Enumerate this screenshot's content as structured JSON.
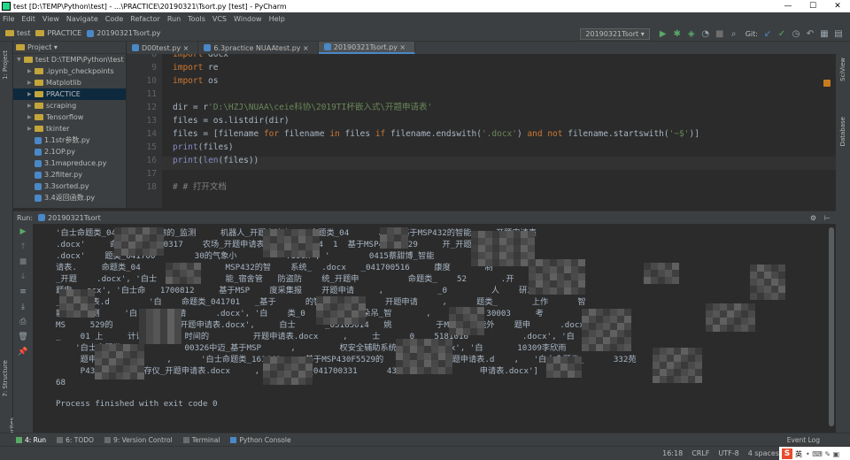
{
  "window": {
    "title": "test [D:\\TEMP\\Python\\test] - ...\\PRACTICE\\20190321\\Tsort.py [test] - PyCharm",
    "minimize": "—",
    "maximize": "☐",
    "close": "✕"
  },
  "menu": [
    "File",
    "Edit",
    "View",
    "Navigate",
    "Code",
    "Refactor",
    "Run",
    "Tools",
    "VCS",
    "Window",
    "Help"
  ],
  "breadcrumbs": [
    "test",
    "PRACTICE",
    "20190321Tsort.py"
  ],
  "run_config": "20190321Tsort ▾",
  "toolbar_icons": [
    "run-icon",
    "debug-icon",
    "coverage-icon",
    "profile-icon",
    "stop-icon",
    "search-icon",
    "git-label",
    "update-icon",
    "commit-icon",
    "history-icon",
    "revert-icon",
    "settings-icon",
    "structure-icon"
  ],
  "git_label": "Git:",
  "project": {
    "header": "Project ▾",
    "items": [
      {
        "label": "test  D:\\TEMP\\Python\\test",
        "indent": 0,
        "type": "folder",
        "open": true
      },
      {
        "label": ".ipynb_checkpoints",
        "indent": 1,
        "type": "folder"
      },
      {
        "label": "Matplotlib",
        "indent": 1,
        "type": "folder"
      },
      {
        "label": "PRACTICE",
        "indent": 1,
        "type": "folder",
        "selected": true
      },
      {
        "label": "scraping",
        "indent": 1,
        "type": "folder"
      },
      {
        "label": "Tensorflow",
        "indent": 1,
        "type": "folder"
      },
      {
        "label": "tkinter",
        "indent": 1,
        "type": "folder"
      },
      {
        "label": "1.1str参数.py",
        "indent": 1,
        "type": "file"
      },
      {
        "label": "2.1OP.py",
        "indent": 1,
        "type": "file"
      },
      {
        "label": "3.1mapreduce.py",
        "indent": 1,
        "type": "file"
      },
      {
        "label": "3.2filter.py",
        "indent": 1,
        "type": "file"
      },
      {
        "label": "3.3sorted.py",
        "indent": 1,
        "type": "file"
      },
      {
        "label": "3.4返回函数.py",
        "indent": 1,
        "type": "file"
      }
    ]
  },
  "editor_tabs": [
    "D00test.py ×",
    "6.3practice NUAAtest.py ×",
    "20190321Tsort.py ×"
  ],
  "active_tab": 2,
  "code_lines": [
    {
      "num": "8",
      "parts": [
        [
          "kw",
          "import "
        ],
        [
          "id",
          "docx"
        ]
      ]
    },
    {
      "num": "9",
      "parts": [
        [
          "kw",
          "import "
        ],
        [
          "id",
          "re"
        ]
      ]
    },
    {
      "num": "10",
      "parts": [
        [
          "kw",
          "import "
        ],
        [
          "id",
          "os"
        ]
      ]
    },
    {
      "num": "11",
      "parts": []
    },
    {
      "num": "12",
      "parts": [
        [
          "id",
          "dir = r"
        ],
        [
          "str",
          "'D:\\HZJ\\NUAA\\ceie科协\\2019TI杯嵌入式\\开题申请表'"
        ]
      ]
    },
    {
      "num": "13",
      "parts": [
        [
          "id",
          "files = os.listdir(dir)"
        ]
      ]
    },
    {
      "num": "14",
      "parts": [
        [
          "id",
          "files = [filename "
        ],
        [
          "kw",
          "for "
        ],
        [
          "id",
          "filename "
        ],
        [
          "kw",
          "in "
        ],
        [
          "id",
          "files "
        ],
        [
          "kw",
          "if "
        ],
        [
          "id",
          "filename.endswith("
        ],
        [
          "str",
          "'.docx'"
        ],
        [
          "id",
          ") "
        ],
        [
          "kw",
          "and not "
        ],
        [
          "id",
          "filename.startswith("
        ],
        [
          "str",
          "'~$'"
        ],
        [
          "id",
          ")]"
        ]
      ]
    },
    {
      "num": "15",
      "parts": [
        [
          "fn",
          "print"
        ],
        [
          "id",
          "(files)"
        ]
      ]
    },
    {
      "num": "16",
      "parts": [
        [
          "fn",
          "print"
        ],
        [
          "id",
          "("
        ],
        [
          "fn",
          "len"
        ],
        [
          "id",
          "(files))"
        ]
      ]
    },
    {
      "num": "17",
      "parts": []
    },
    {
      "num": "18",
      "parts": [
        [
          "cm",
          "# # 打开文档"
        ]
      ]
    }
  ],
  "run_panel": {
    "label": "Run:",
    "tab": "20190321Tsort"
  },
  "console_lines": [
    "'白士命题类_041601004中德的_监测     机器人_开题申请表.d  命题类_04      、5_ 基于MSP432的智能     开题申请表",
    ".docx'     命题类_041700317    农场_开题申请表    命题类_04  1  基于MSP430F5529     开_开题申请",
    ".docx'    题类_041700        30的气象小          .docx', '        0415蔡甜博_智能         体化系统_开",
    "请表.     命题类_04         齐鹏     MSP432的智    系统_  .docx   _041700516     康度       制",
    "_开题    .docx', '白士   41700      能_宿舍管   防盗防    统_开题申          命题类_    52       .开",
    "题申   ocx', '白士命   1700812     基于MSP    度采集报    开题申请     ,           _0         人    研发",
    "_开题   表.d        '白    命题类_041701   _基于      的智能家居        开题申请     ,      题类_       上作      智",
    "能    监测     '白     题申请      .docx', '白    类_0         8孙朵吊_智       ,     题类   30003     考   ",
    "MS     529的       种     开题申请表.docx',     白士      _05163014   姚         于MS     能外    题申      .docx', '白",
    "_    01 上     计记录仪     时间的         开题申请表.docx     ,     士     _0    5181016           .docx', '白   题",
    "    '白士命题类_040         00326中迈_基于MSP      ,         权安全辅助系统         ocx', '白       10309李欣雨     移动",
    "     题申请表.docx'     ,      '白士命题类_161640     基于MSP430F5529的        李箱_开题申请表.d    ,   '白士命题类_      332苑",
    "     P432的液    干存仪_开题申请表.docx     ,     命题类_041700331      430的电子密码锁      申请表.docx']",
    "68",
    "",
    "Process finished with exit code 0"
  ],
  "bottom_tabs": [
    "4: Run",
    "6: TODO",
    "9: Version Control",
    "Terminal",
    "Python Console"
  ],
  "event_log": "Event Log",
  "status": {
    "position": "16:18",
    "line_sep": "CRLF",
    "encoding": "UTF-8",
    "indent": "4 spaces",
    "ime": "英"
  }
}
